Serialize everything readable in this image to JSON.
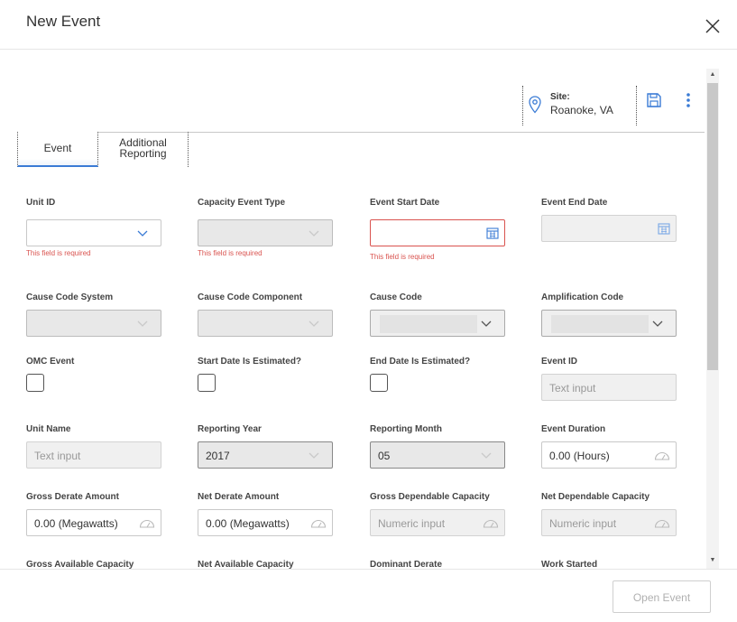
{
  "dialog": {
    "title": "New Event"
  },
  "site": {
    "label": "Site:",
    "value": "Roanoke, VA"
  },
  "tabs": [
    {
      "label": "Event"
    },
    {
      "label": "Additional Reporting"
    }
  ],
  "fields": {
    "unit_id": {
      "label": "Unit ID",
      "error": "This field is required"
    },
    "capacity_event_type": {
      "label": "Capacity Event Type",
      "error": "This field is required"
    },
    "event_start_date": {
      "label": "Event Start Date",
      "error": "This field is required"
    },
    "event_end_date": {
      "label": "Event End Date"
    },
    "cause_code_system": {
      "label": "Cause Code System"
    },
    "cause_code_component": {
      "label": "Cause Code Component"
    },
    "cause_code": {
      "label": "Cause Code"
    },
    "amplification_code": {
      "label": "Amplification Code"
    },
    "omc_event": {
      "label": "OMC Event"
    },
    "start_date_estimated": {
      "label": "Start Date Is Estimated?"
    },
    "end_date_estimated": {
      "label": "End Date Is Estimated?"
    },
    "event_id": {
      "label": "Event ID",
      "placeholder": "Text input"
    },
    "unit_name": {
      "label": "Unit Name",
      "placeholder": "Text input"
    },
    "reporting_year": {
      "label": "Reporting Year",
      "value": "2017"
    },
    "reporting_month": {
      "label": "Reporting Month",
      "value": "05"
    },
    "event_duration": {
      "label": "Event Duration",
      "value": "0.00 (Hours)"
    },
    "gross_derate_amount": {
      "label": "Gross Derate Amount",
      "value": "0.00 (Megawatts)"
    },
    "net_derate_amount": {
      "label": "Net Derate Amount",
      "value": "0.00 (Megawatts)"
    },
    "gross_dependable_capacity": {
      "label": "Gross Dependable Capacity",
      "placeholder": "Numeric input"
    },
    "net_dependable_capacity": {
      "label": "Net Dependable Capacity",
      "placeholder": "Numeric input"
    },
    "gross_available_capacity": {
      "label": "Gross Available Capacity"
    },
    "net_available_capacity": {
      "label": "Net Available Capacity"
    },
    "dominant_derate": {
      "label": "Dominant Derate"
    },
    "work_started": {
      "label": "Work Started"
    }
  },
  "footer": {
    "open_event_label": "Open Event"
  },
  "colors": {
    "accent": "#3a7bd5",
    "error": "#d9534f",
    "disabled_text": "#b0b0b0"
  }
}
